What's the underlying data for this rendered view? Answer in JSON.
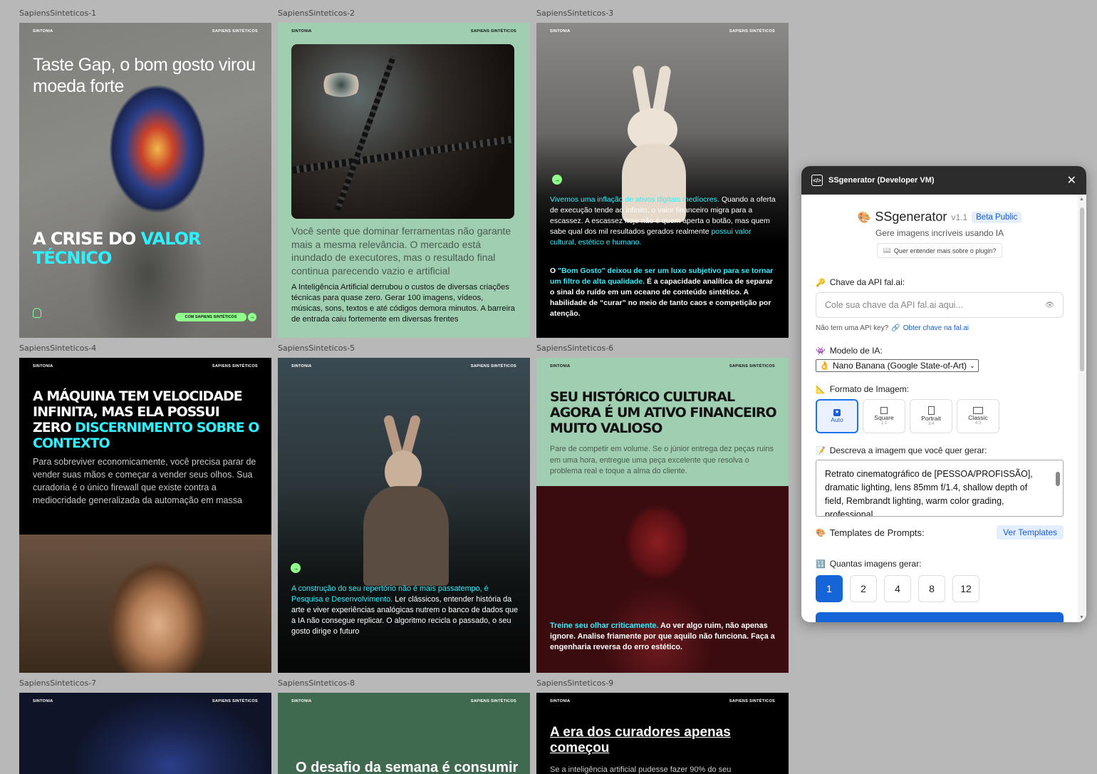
{
  "frames": [
    {
      "label": "SapiensSinteticos-1",
      "brand_left": "SINTONIA",
      "brand_right": "SAPIENS SINTÉTICOS",
      "subtitle": "Taste Gap, o bom gosto virou moeda forte",
      "headline_white": "A CRISE DO ",
      "headline_cyan_1": "VALOR",
      "headline_cyan_2": "TÉCNICO",
      "cta": "COM SAPIENS SINTÉTICOS"
    },
    {
      "label": "SapiensSinteticos-2",
      "brand_left": "SINTONIA",
      "brand_right": "SAPIENS SINTÉTICOS",
      "lead": "Você sente que dominar ferramentas não garante mais a mesma relevância. O mercado está inundado de executores, mas o resultado final continua parecendo vazio e artificial",
      "body": "A Inteligência Artificial derrubou o custos de diversas criações técnicas para quase zero. Gerar 100 imagens, vídeos, músicas, sons, textos e até códigos demora minutos. A barreira de entrada caiu fortemente em diversas frentes"
    },
    {
      "label": "SapiensSinteticos-3",
      "brand_left": "SINTONIA",
      "brand_right": "SAPIENS SINTÉTICOS",
      "p1_cyan": "Vivemos uma inflação de ativos digitais medíocres.",
      "p1_white": " Quando a oferta de execução tende ao infinito, o valor financeiro migra para a escassez. A escassez hoje não é quem aperta o botão, mas quem sabe qual dos mil resultados gerados realmente ",
      "p1_cyan_end": "possui valor cultural, estético e humano.",
      "p2_white_start": "O ",
      "p2_cyan": "\"Bom Gosto\" deixou de ser um luxo subjetivo para se tornar um filtro de alta qualidade.",
      "p2_white": " É a capacidade analítica de separar o sinal do ruído em um oceano de conteúdo sintético. A habilidade de “curar” no meio de tanto caos e competição por atenção."
    },
    {
      "label": "SapiensSinteticos-4",
      "brand_left": "SINTONIA",
      "brand_right": "SAPIENS SINTÉTICOS",
      "headline_white": "A MÁQUINA TEM VELOCIDADE INFINITA, MAS ELA POSSUI ZERO",
      "headline_cyan": "DISCERNIMENTO SOBRE O CONTEXTO",
      "body": "Para sobreviver economicamente, você precisa parar de vender suas mãos e começar a vender seus olhos. Sua curadoria é o único firewall que existe contra a mediocridade generalizada da automação em massa"
    },
    {
      "label": "SapiensSinteticos-5",
      "brand_left": "SINTONIA",
      "brand_right": "SAPIENS SINTÉTICOS",
      "cyan": "A construção do seu repertório não é mais passatempo, é Pesquisa e Desenvolvimento.",
      "white": " Ler clássicos, entender história da arte e viver experiências analógicas nutrem o banco de dados que a IA não consegue replicar. O algoritmo recicla o passado, o seu gosto dirige o futuro"
    },
    {
      "label": "SapiensSinteticos-6",
      "brand_left": "SINTONIA",
      "brand_right": "SAPIENS SINTÉTICOS",
      "headline": "SEU HISTÓRICO CULTURAL AGORA É UM ATIVO FINANCEIRO MUITO VALIOSO",
      "body": "Pare de competir em volume. Se o júnior entrega dez peças ruins em uma hora, entregue uma peça excelente que resolva o problema real e toque a alma do cliente.",
      "cyan": "Treine seu olhar criticamente.",
      "white": " Ao ver algo ruim, não apenas ignore. Analise friamente por que aquilo não funciona. Faça a engenharia reversa do erro estético."
    },
    {
      "label": "SapiensSinteticos-7",
      "brand_left": "SINTONIA",
      "brand_right": "SAPIENS SINTÉTICOS"
    },
    {
      "label": "SapiensSinteticos-8",
      "brand_left": "SINTONIA",
      "brand_right": "SAPIENS SINTÉTICOS",
      "headline": "O desafio da semana é consumir"
    },
    {
      "label": "SapiensSinteticos-9",
      "brand_left": "SINTONIA",
      "brand_right": "SAPIENS SINTÉTICOS",
      "headline": "A era dos curadores apenas começou",
      "body": "Se a inteligência artificial pudesse fazer 90% do seu"
    }
  ],
  "plugin": {
    "window_title": "SSgenerator (Developer VM)",
    "app_name": "SSgenerator",
    "version": "v1.1",
    "badge": "Beta Public",
    "tagline": "Gere imagens incríveis usando IA",
    "learn_more": "Quer entender mais sobre o plugin?",
    "api_label": "Chave da API fal.ai:",
    "api_placeholder": "Cole sua chave da API fal.ai aqui...",
    "no_key": "Não tem uma API key?",
    "get_key": "Obter chave na fal.ai",
    "model_label": "Modelo de IA:",
    "model_value": "Nano Banana (Google State-of-Art)",
    "format_label": "Formato de Imagem:",
    "formats": [
      {
        "name": "Auto",
        "ratio": ""
      },
      {
        "name": "Square",
        "ratio": "1:1"
      },
      {
        "name": "Portrait",
        "ratio": "3:4"
      },
      {
        "name": "Classic",
        "ratio": "4:3"
      }
    ],
    "prompt_label": "Descreva a imagem que você quer gerar:",
    "prompt_value": "Retrato cinematográfico de [PESSOA/PROFISSÃO], dramatic lighting, lens 85mm f/1.4, shallow depth of field, Rembrandt lighting, warm color grading, professional",
    "templates_label": "Templates de Prompts:",
    "templates_button": "Ver Templates",
    "count_label": "Quantas imagens gerar:",
    "counts": [
      "1",
      "2",
      "4",
      "8",
      "12"
    ]
  }
}
